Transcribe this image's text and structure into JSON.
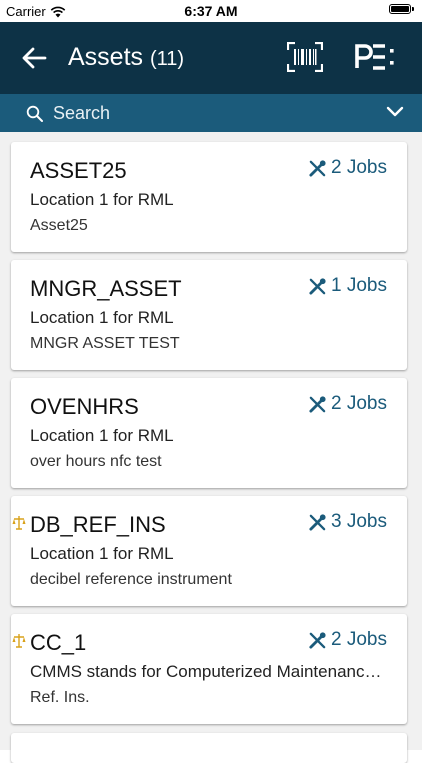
{
  "status_bar": {
    "carrier": "Carrier",
    "time": "6:37 AM",
    "battery_level": 1.0
  },
  "nav": {
    "title": "Assets",
    "count": "(11)"
  },
  "search": {
    "placeholder": "Search"
  },
  "assets": [
    {
      "name": "ASSET25",
      "location": "Location 1 for RML",
      "description": "Asset25",
      "jobs": "2 Jobs",
      "reference": false
    },
    {
      "name": "MNGR_ASSET",
      "location": "Location 1 for RML",
      "description": "MNGR ASSET TEST",
      "jobs": "1 Jobs",
      "reference": false
    },
    {
      "name": "OVENHRS",
      "location": "Location 1 for RML",
      "description": "over hours nfc test",
      "jobs": "2 Jobs",
      "reference": false
    },
    {
      "name": "DB_REF_INS",
      "location": "Location 1 for RML",
      "description": "decibel reference instrument",
      "jobs": "3 Jobs",
      "reference": true
    },
    {
      "name": "CC_1",
      "location": "CMMS stands for Computerized Maintenance Management System",
      "description": "Ref. Ins.",
      "jobs": "2 Jobs",
      "reference": true
    }
  ],
  "colors": {
    "nav_bg": "#0d3246",
    "search_bg": "#1b5b7b",
    "accent": "#1b5b7b",
    "reference_icon": "#d9a21b"
  },
  "icons": {
    "back": "back-arrow-icon",
    "barcode": "barcode-scan-icon",
    "pe": "pe-menu-icon",
    "search": "search-icon",
    "expand": "chevron-down-icon",
    "jobs": "wrench-screwdriver-icon",
    "reference": "reference-instrument-icon"
  }
}
